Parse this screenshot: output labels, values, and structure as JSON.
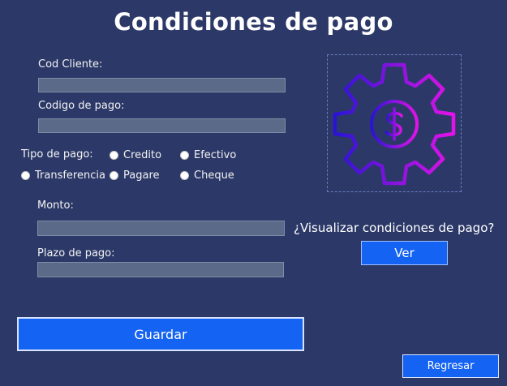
{
  "header": {
    "title": "Condiciones de pago"
  },
  "form": {
    "cod_cliente_label": "Cod Cliente:",
    "cod_cliente_value": "",
    "codigo_pago_label": "Codigo de pago:",
    "codigo_pago_value": "",
    "tipo_pago_label": "Tipo de pago:",
    "payment_types": [
      "Credito",
      "Efectivo",
      "Transferencia",
      "Pagare",
      "Cheque"
    ],
    "monto_label": "Monto:",
    "monto_value": "",
    "plazo_label": "Plazo de pago:",
    "plazo_value": ""
  },
  "side": {
    "illustration_icon": "gear-dollar-icon",
    "question": "¿Visualizar condiciones de pago?",
    "ver_label": "Ver"
  },
  "actions": {
    "guardar_label": "Guardar",
    "regresar_label": "Regresar"
  },
  "colors": {
    "background": "#2c3968",
    "field": "#5b6a88",
    "button": "#1463f2",
    "gear_start": "#2a13d6",
    "gear_end": "#e313e8"
  }
}
